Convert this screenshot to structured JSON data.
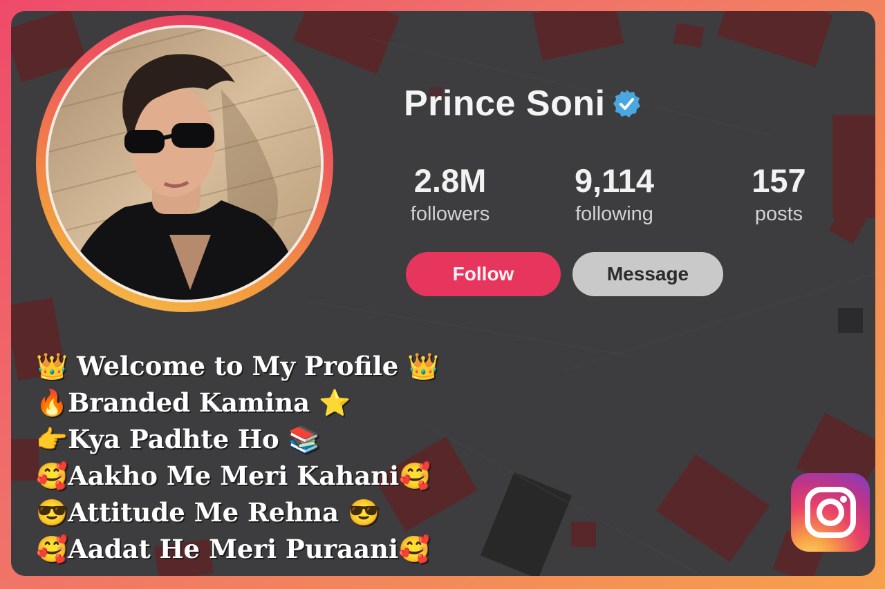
{
  "profile": {
    "name": "Prince Soni",
    "verified_icon": "verified-badge-icon",
    "avatar_icon": "profile-photo"
  },
  "stats": [
    {
      "value": "2.8M",
      "label": "followers"
    },
    {
      "value": "9,114",
      "label": "following"
    },
    {
      "value": "157",
      "label": "posts"
    }
  ],
  "actions": {
    "follow_label": "Follow",
    "message_label": "Message"
  },
  "bio": [
    "👑 Welcome to My Profile 👑",
    "🔥Branded Kamina ⭐",
    "👉Kya Padhte Ho 📚",
    "🥰Aakho Me Meri Kahani🥰",
    "😎Attitude Me Rehna 😎",
    "🥰Aadat He Meri Puraani🥰"
  ],
  "brand": {
    "logo_icon": "instagram-logo-icon"
  },
  "colors": {
    "follow_button": "#e7365e",
    "message_button": "#c9c9c9",
    "verified_badge": "#4aa6e0",
    "card_background": "#3d3d3f"
  }
}
